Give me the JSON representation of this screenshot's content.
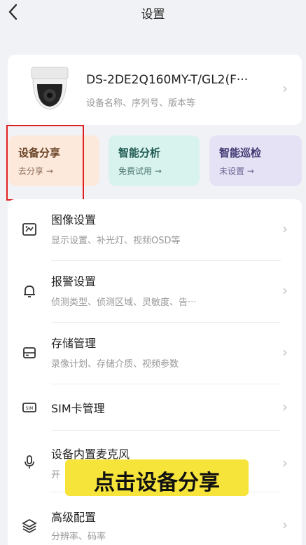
{
  "header": {
    "back_icon": "chevron-left-icon",
    "title": "设置"
  },
  "device": {
    "name": "DS-2DE2Q160MY-T/GL2(F···",
    "subtitle": "设备名称、序列号、版本等"
  },
  "quick_actions": [
    {
      "title": "设备分享",
      "subtitle": "去分享 →"
    },
    {
      "title": "智能分析",
      "subtitle": "免费试用 →"
    },
    {
      "title": "智能巡检",
      "subtitle": "未设置 →"
    }
  ],
  "settings": [
    {
      "title": "图像设置",
      "subtitle": "显示设置、补光灯、视频OSD等",
      "icon": "image-settings-icon"
    },
    {
      "title": "报警设置",
      "subtitle": "侦测类型、侦测区域、灵敏度、告···",
      "icon": "alarm-bell-icon"
    },
    {
      "title": "存储管理",
      "subtitle": "录像计划、存储介质、视频参数",
      "icon": "storage-icon"
    },
    {
      "title": "SIM卡管理",
      "subtitle": "",
      "icon": "sim-card-icon"
    },
    {
      "title": "设备内置麦克风",
      "subtitle": "开",
      "icon": "microphone-icon"
    },
    {
      "title": "高级配置",
      "subtitle": "分辨率、码率",
      "icon": "layers-icon"
    }
  ],
  "overlay": {
    "caption": "点击设备分享"
  },
  "colors": {
    "highlight": "#e02020",
    "caption_bg": "#f7e43b"
  }
}
